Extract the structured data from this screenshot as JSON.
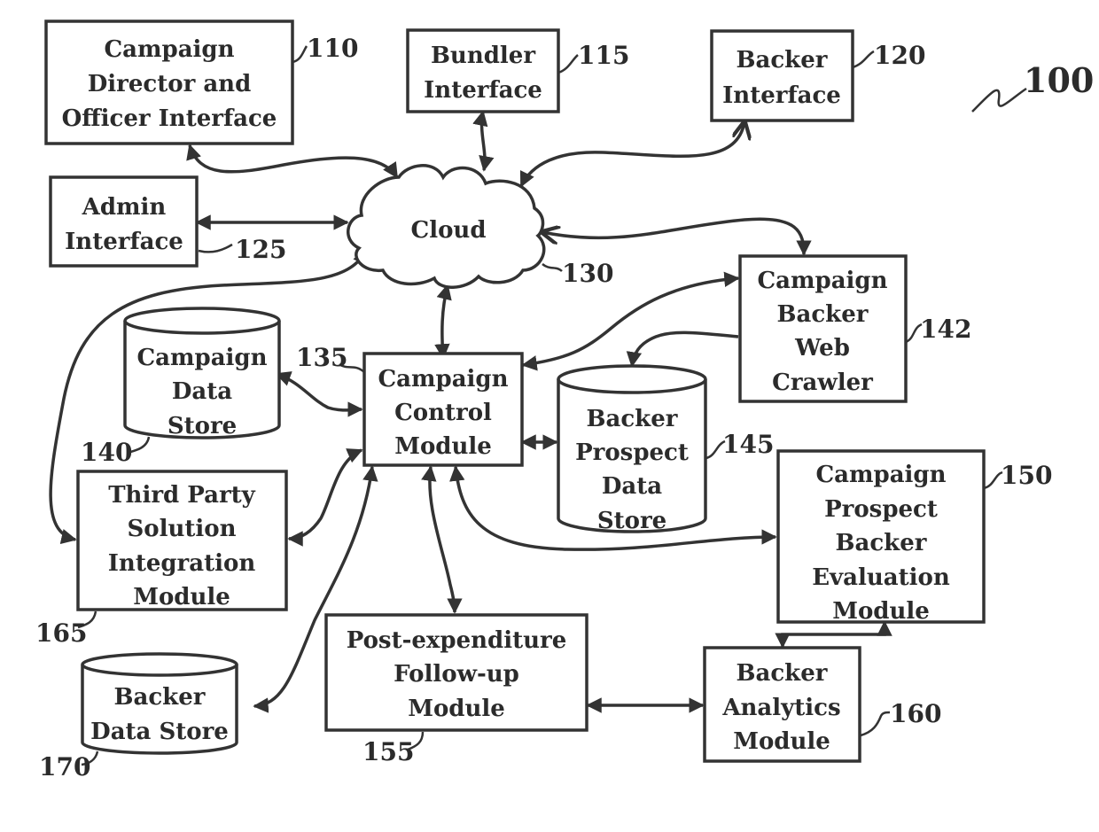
{
  "figure": {
    "reference": "100",
    "colors": {
      "ink": "#333333",
      "background": "#ffffff"
    }
  },
  "nodes": {
    "director_interface": {
      "ref": "110",
      "lines": [
        "Campaign",
        "Director and",
        "Officer Interface"
      ]
    },
    "bundler_interface": {
      "ref": "115",
      "lines": [
        "Bundler",
        "Interface"
      ]
    },
    "backer_interface": {
      "ref": "120",
      "lines": [
        "Backer",
        "Interface"
      ]
    },
    "admin_interface": {
      "ref": "125",
      "lines": [
        "Admin",
        "Interface"
      ]
    },
    "cloud": {
      "ref": "130",
      "lines": [
        "Cloud"
      ]
    },
    "control_module": {
      "ref": "135",
      "lines": [
        "Campaign",
        "Control",
        "Module"
      ]
    },
    "campaign_data_store": {
      "ref": "140",
      "lines": [
        "Campaign",
        "Data",
        "Store"
      ]
    },
    "web_crawler": {
      "ref": "142",
      "lines": [
        "Campaign",
        "Backer",
        "Web",
        "Crawler"
      ]
    },
    "prospect_data_store": {
      "ref": "145",
      "lines": [
        "Backer",
        "Prospect",
        "Data",
        "Store"
      ]
    },
    "evaluation_module": {
      "ref": "150",
      "lines": [
        "Campaign",
        "Prospect",
        "Backer",
        "Evaluation",
        "Module"
      ]
    },
    "followup_module": {
      "ref": "155",
      "lines": [
        "Post-expenditure",
        "Follow-up",
        "Module"
      ]
    },
    "analytics_module": {
      "ref": "160",
      "lines": [
        "Backer",
        "Analytics",
        "Module"
      ]
    },
    "third_party_module": {
      "ref": "165",
      "lines": [
        "Third Party",
        "Solution",
        "Integration",
        "Module"
      ]
    },
    "backer_data_store": {
      "ref": "170",
      "lines": [
        "Backer",
        "Data Store"
      ]
    }
  },
  "edges": [
    {
      "from": "director_interface",
      "to": "cloud",
      "direction": "both"
    },
    {
      "from": "bundler_interface",
      "to": "cloud",
      "direction": "both"
    },
    {
      "from": "backer_interface",
      "to": "cloud",
      "direction": "both"
    },
    {
      "from": "admin_interface",
      "to": "cloud",
      "direction": "both"
    },
    {
      "from": "cloud",
      "to": "web_crawler",
      "direction": "both"
    },
    {
      "from": "cloud",
      "to": "third_party_module",
      "direction": "both"
    },
    {
      "from": "cloud",
      "to": "control_module",
      "direction": "both"
    },
    {
      "from": "web_crawler",
      "to": "control_module",
      "direction": "both"
    },
    {
      "from": "web_crawler",
      "to": "prospect_data_store",
      "direction": "forward"
    },
    {
      "from": "campaign_data_store",
      "to": "control_module",
      "direction": "both"
    },
    {
      "from": "control_module",
      "to": "prospect_data_store",
      "direction": "both"
    },
    {
      "from": "control_module",
      "to": "third_party_module",
      "direction": "both"
    },
    {
      "from": "control_module",
      "to": "backer_data_store",
      "direction": "both"
    },
    {
      "from": "control_module",
      "to": "followup_module",
      "direction": "both"
    },
    {
      "from": "control_module",
      "to": "evaluation_module",
      "direction": "both"
    },
    {
      "from": "followup_module",
      "to": "analytics_module",
      "direction": "both"
    },
    {
      "from": "evaluation_module",
      "to": "analytics_module",
      "direction": "both"
    }
  ]
}
